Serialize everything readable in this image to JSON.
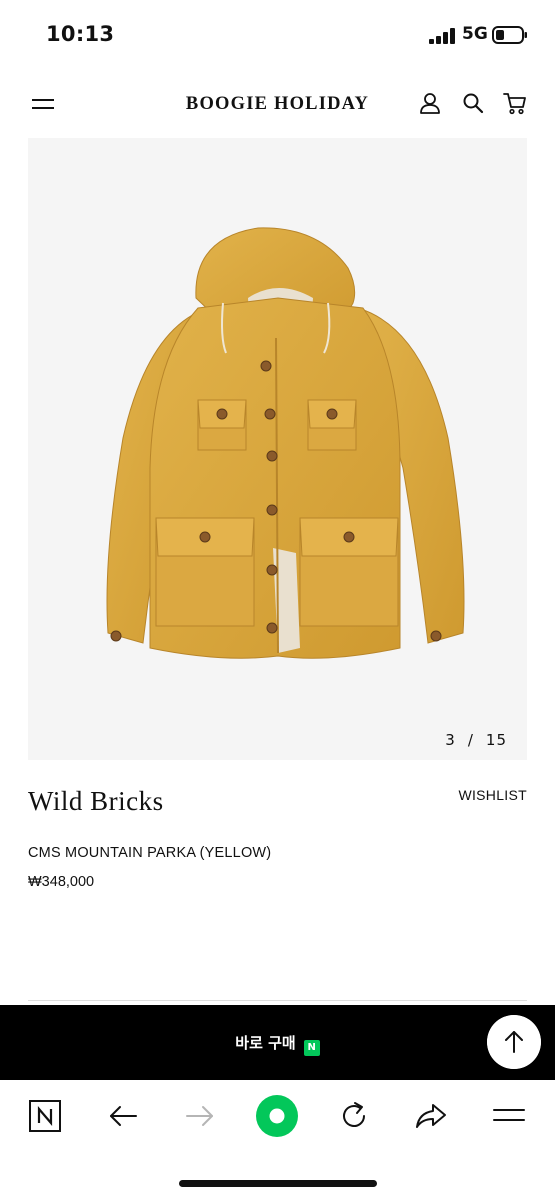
{
  "status_bar": {
    "time": "10:13",
    "network": "5G"
  },
  "header": {
    "brand": "BOOGIE HOLIDAY",
    "icons": [
      "menu-icon",
      "user-icon",
      "search-icon",
      "cart-icon"
    ]
  },
  "gallery": {
    "current": "3",
    "separator": "/",
    "total": "15"
  },
  "product": {
    "brand_name": "Wild Bricks",
    "wishlist_label": "WISHLIST",
    "name": "CMS MOUNTAIN PARKA (YELLOW)",
    "price": "₩348,000",
    "color": "#d9a83e"
  },
  "buy_bar": {
    "label": "바로 구매",
    "badge": "N"
  },
  "browser_bar": {
    "icons": [
      "naver-logo-icon",
      "back-icon",
      "forward-icon",
      "home-icon",
      "refresh-icon",
      "share-icon",
      "menu-icon"
    ]
  },
  "colors": {
    "accent_green": "#03c75a",
    "bar_black": "#000000",
    "image_bg": "#f5f5f5"
  }
}
